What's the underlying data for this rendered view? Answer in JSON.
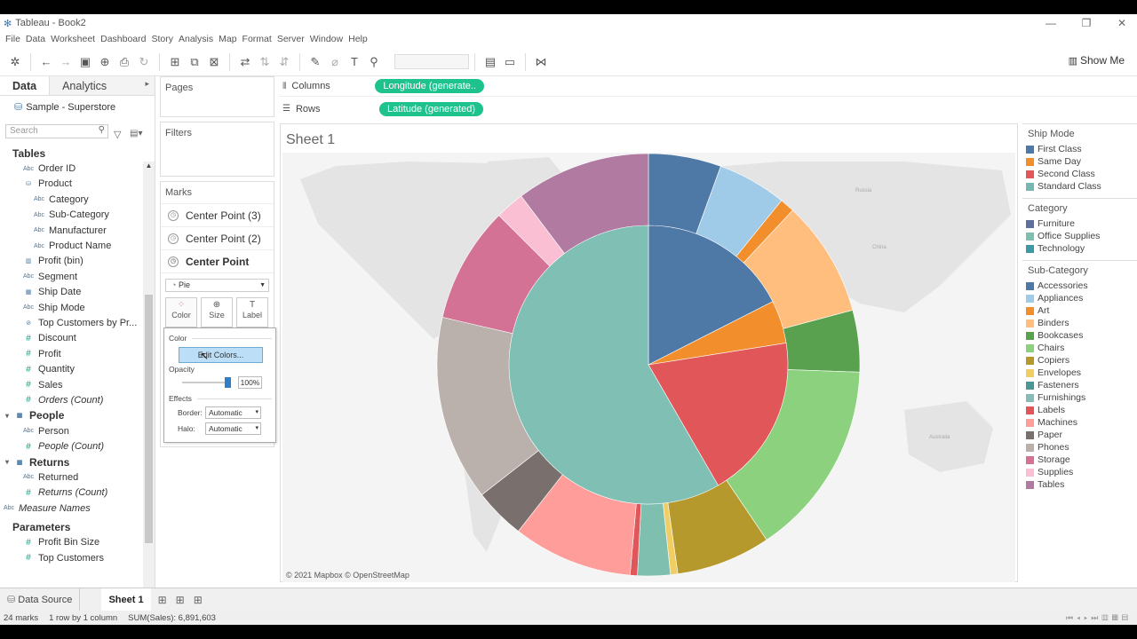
{
  "window": {
    "title": "Tableau - Book2"
  },
  "menu": [
    "File",
    "Data",
    "Worksheet",
    "Dashboard",
    "Story",
    "Analysis",
    "Map",
    "Format",
    "Server",
    "Window",
    "Help"
  ],
  "toolbar": {
    "show_me": "Show Me"
  },
  "data_pane": {
    "tab_data": "Data",
    "tab_analytics": "Analytics",
    "datasource": "Sample - Superstore",
    "search_placeholder": "Search",
    "fields": [
      {
        "label": "Tables",
        "kind": "header",
        "indent": 0,
        "icon": ""
      },
      {
        "label": "Order ID",
        "kind": "dim",
        "indent": 1,
        "icon": "Abc"
      },
      {
        "label": "Product",
        "kind": "dim",
        "indent": 1,
        "icon": "⛁"
      },
      {
        "label": "Category",
        "kind": "dim",
        "indent": 2,
        "icon": "Abc"
      },
      {
        "label": "Sub-Category",
        "kind": "dim",
        "indent": 2,
        "icon": "Abc"
      },
      {
        "label": "Manufacturer",
        "kind": "dim",
        "indent": 2,
        "icon": "Abc"
      },
      {
        "label": "Product Name",
        "kind": "dim",
        "indent": 2,
        "icon": "Abc"
      },
      {
        "label": "Profit (bin)",
        "kind": "dim",
        "indent": 1,
        "icon": "▥"
      },
      {
        "label": "Segment",
        "kind": "dim",
        "indent": 1,
        "icon": "Abc"
      },
      {
        "label": "Ship Date",
        "kind": "dim",
        "indent": 1,
        "icon": "▦"
      },
      {
        "label": "Ship Mode",
        "kind": "dim",
        "indent": 1,
        "icon": "Abc"
      },
      {
        "label": "Top Customers by Pr...",
        "kind": "dim",
        "indent": 1,
        "icon": "⊘"
      },
      {
        "label": "Discount",
        "kind": "meas",
        "indent": 1,
        "icon": "#"
      },
      {
        "label": "Profit",
        "kind": "meas",
        "indent": 1,
        "icon": "#"
      },
      {
        "label": "Quantity",
        "kind": "meas",
        "indent": 1,
        "icon": "#"
      },
      {
        "label": "Sales",
        "kind": "meas",
        "indent": 1,
        "icon": "#"
      },
      {
        "label": "Orders (Count)",
        "kind": "measi",
        "indent": 1,
        "icon": "#"
      },
      {
        "label": "People",
        "kind": "subhdr",
        "indent": 0,
        "icon": "▦"
      },
      {
        "label": "Person",
        "kind": "dim",
        "indent": 1,
        "icon": "Abc"
      },
      {
        "label": "People (Count)",
        "kind": "measi",
        "indent": 1,
        "icon": "#"
      },
      {
        "label": "Returns",
        "kind": "subhdr",
        "indent": 0,
        "icon": "▦"
      },
      {
        "label": "Returned",
        "kind": "dim",
        "indent": 1,
        "icon": "Abc"
      },
      {
        "label": "Returns (Count)",
        "kind": "measi",
        "indent": 1,
        "icon": "#"
      },
      {
        "label": "Measure Names",
        "kind": "dimi",
        "indent": 0,
        "icon": "Abc"
      },
      {
        "label": "Parameters",
        "kind": "header",
        "indent": 0,
        "icon": ""
      },
      {
        "label": "Profit Bin Size",
        "kind": "meas",
        "indent": 1,
        "icon": "#"
      },
      {
        "label": "Top Customers",
        "kind": "meas",
        "indent": 1,
        "icon": "#"
      }
    ]
  },
  "shelves": {
    "pages": "Pages",
    "filters": "Filters",
    "columns_label": "Columns",
    "rows_label": "Rows",
    "columns_pill": "Longitude (generate..",
    "rows_pill": "Latitude (generated)"
  },
  "marks": {
    "title": "Marks",
    "layers": [
      "Center Point (3)",
      "Center Point (2)",
      "Center Point"
    ],
    "mark_type": "Pie",
    "buttons": [
      "Color",
      "Size",
      "Label"
    ],
    "color_popup": {
      "section_color": "Color",
      "edit_colors": "Edit Colors...",
      "section_opacity": "Opacity",
      "opacity_value": "100%",
      "section_effects": "Effects",
      "border_label": "Border:",
      "border_value": "Automatic",
      "halo_label": "Halo:",
      "halo_value": "Automatic"
    }
  },
  "sheet": {
    "title": "Sheet 1",
    "attribution": "© 2021 Mapbox © OpenStreetMap"
  },
  "legends": [
    {
      "title": "Ship Mode",
      "items": [
        {
          "label": "First Class",
          "color": "#4e79a7"
        },
        {
          "label": "Same Day",
          "color": "#f28e2b"
        },
        {
          "label": "Second Class",
          "color": "#e15759"
        },
        {
          "label": "Standard Class",
          "color": "#76b7b2"
        }
      ]
    },
    {
      "title": "Category",
      "items": [
        {
          "label": "Furniture",
          "color": "#5e6f9e"
        },
        {
          "label": "Office Supplies",
          "color": "#7fbfb0"
        },
        {
          "label": "Technology",
          "color": "#3d9aa5"
        }
      ]
    },
    {
      "title": "Sub-Category",
      "items": [
        {
          "label": "Accessories",
          "color": "#4e79a7"
        },
        {
          "label": "Appliances",
          "color": "#a0cbe8"
        },
        {
          "label": "Art",
          "color": "#f28e2b"
        },
        {
          "label": "Binders",
          "color": "#ffbe7d"
        },
        {
          "label": "Bookcases",
          "color": "#59a14f"
        },
        {
          "label": "Chairs",
          "color": "#8cd17d"
        },
        {
          "label": "Copiers",
          "color": "#b6992d"
        },
        {
          "label": "Envelopes",
          "color": "#f1ce63"
        },
        {
          "label": "Fasteners",
          "color": "#499894"
        },
        {
          "label": "Furnishings",
          "color": "#86bcb6"
        },
        {
          "label": "Labels",
          "color": "#e15759"
        },
        {
          "label": "Machines",
          "color": "#ff9d9a"
        },
        {
          "label": "Paper",
          "color": "#79706e"
        },
        {
          "label": "Phones",
          "color": "#bab0ac"
        },
        {
          "label": "Storage",
          "color": "#d37295"
        },
        {
          "label": "Supplies",
          "color": "#fabfd2"
        },
        {
          "label": "Tables",
          "color": "#b07aa1"
        }
      ]
    }
  ],
  "chart_data": {
    "type": "pie",
    "inner_ring": [
      {
        "label": "First Class",
        "color": "#4e79a7",
        "start_deg": 0,
        "end_deg": 63
      },
      {
        "label": "Same Day",
        "color": "#f28e2b",
        "start_deg": 63,
        "end_deg": 81
      },
      {
        "label": "Second Class",
        "color": "#e15759",
        "start_deg": 81,
        "end_deg": 150
      },
      {
        "label": "Standard Class",
        "color": "#80bfb3",
        "start_deg": 150,
        "end_deg": 360
      }
    ],
    "outer_ring": [
      {
        "label": "Accessories",
        "color": "#4e79a7",
        "start_deg": 0,
        "end_deg": 20
      },
      {
        "label": "Appliances",
        "color": "#a0cbe8",
        "start_deg": 20,
        "end_deg": 39
      },
      {
        "label": "Art",
        "color": "#f28e2b",
        "start_deg": 39,
        "end_deg": 43
      },
      {
        "label": "Binders",
        "color": "#ffbe7d",
        "start_deg": 43,
        "end_deg": 75
      },
      {
        "label": "Bookcases",
        "color": "#59a14f",
        "start_deg": 75,
        "end_deg": 92
      },
      {
        "label": "Chairs",
        "color": "#8cd17d",
        "start_deg": 92,
        "end_deg": 146
      },
      {
        "label": "Copiers",
        "color": "#b6992d",
        "start_deg": 146,
        "end_deg": 172
      },
      {
        "label": "Envelopes",
        "color": "#f1ce63",
        "start_deg": 172,
        "end_deg": 174
      },
      {
        "label": "Fasteners",
        "color": "#7fbfb0",
        "start_deg": 174,
        "end_deg": 183
      },
      {
        "label": "Labels",
        "color": "#e15759",
        "start_deg": 183,
        "end_deg": 185
      },
      {
        "label": "Machines",
        "color": "#ff9d9a",
        "start_deg": 185,
        "end_deg": 218
      },
      {
        "label": "Paper",
        "color": "#79706e",
        "start_deg": 218,
        "end_deg": 232
      },
      {
        "label": "Phones",
        "color": "#bab0ac",
        "start_deg": 232,
        "end_deg": 283
      },
      {
        "label": "Storage",
        "color": "#d37295",
        "start_deg": 283,
        "end_deg": 315
      },
      {
        "label": "Supplies",
        "color": "#fabfd2",
        "start_deg": 315,
        "end_deg": 323
      },
      {
        "label": "Tables",
        "color": "#b07aa1",
        "start_deg": 323,
        "end_deg": 360
      }
    ]
  },
  "bottom": {
    "data_source_tab": "Data Source",
    "sheet_tab": "Sheet 1",
    "status_marks": "24 marks",
    "status_dims": "1 row by 1 column",
    "status_sum": "SUM(Sales): 6,891,603"
  }
}
